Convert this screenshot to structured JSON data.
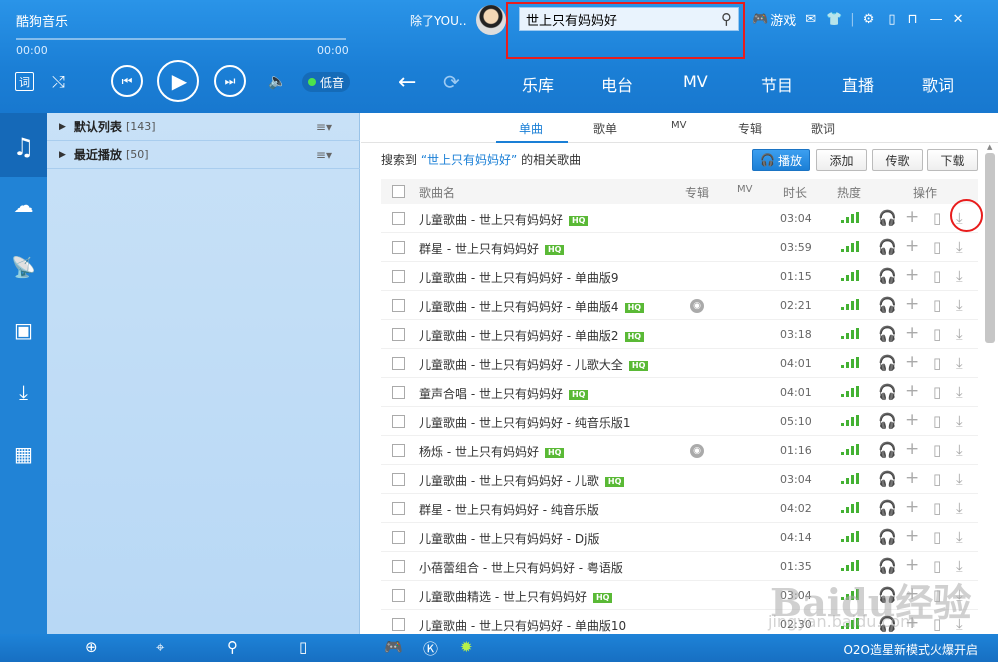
{
  "app": {
    "title": "酷狗音乐",
    "time_elapsed": "00:00",
    "time_total": "00:00",
    "progress": 0
  },
  "player": {
    "lyric_label": "词",
    "quality_label": "低音"
  },
  "user": {
    "name": "除了YOU.."
  },
  "search": {
    "value": "世上只有妈妈好"
  },
  "topbar": {
    "game_label": "游戏"
  },
  "nav": {
    "items": [
      "乐库",
      "电台",
      "MV",
      "节目",
      "直播",
      "歌词"
    ]
  },
  "playlists": [
    {
      "label": "默认列表",
      "count": "[143]"
    },
    {
      "label": "最近播放",
      "count": "[50]"
    }
  ],
  "tabs": [
    "单曲",
    "歌单",
    "MV",
    "专辑",
    "歌词"
  ],
  "result": {
    "prefix": "搜索到",
    "query": "“世上只有妈妈好”",
    "suffix": "的相关歌曲"
  },
  "actions": {
    "play": "播放",
    "add": "添加",
    "share": "传歌",
    "download": "下载"
  },
  "columns": {
    "name": "歌曲名",
    "album": "专辑",
    "mv": "MV",
    "duration": "时长",
    "heat": "热度",
    "ops": "操作"
  },
  "songs": [
    {
      "name": "儿童歌曲 - 世上只有妈妈好",
      "hq": "HQ",
      "album": false,
      "duration": "03:04"
    },
    {
      "name": "群星 - 世上只有妈妈好",
      "hq": "HQ",
      "album": false,
      "duration": "03:59"
    },
    {
      "name": "儿童歌曲 - 世上只有妈妈好 - 单曲版9",
      "hq": "",
      "album": false,
      "duration": "01:15"
    },
    {
      "name": "儿童歌曲 - 世上只有妈妈好 - 单曲版4",
      "hq": "HQ",
      "album": true,
      "duration": "02:21"
    },
    {
      "name": "儿童歌曲 - 世上只有妈妈好 - 单曲版2",
      "hq": "HQ",
      "album": false,
      "duration": "03:18"
    },
    {
      "name": "儿童歌曲 - 世上只有妈妈好 - 儿歌大全",
      "hq": "HQ",
      "album": false,
      "duration": "04:01"
    },
    {
      "name": "童声合唱 - 世上只有妈妈好",
      "hq": "HQ",
      "album": false,
      "duration": "04:01"
    },
    {
      "name": "儿童歌曲 - 世上只有妈妈好 - 纯音乐版1",
      "hq": "",
      "album": false,
      "duration": "05:10"
    },
    {
      "name": "杨烁 - 世上只有妈妈好",
      "hq": "HQ",
      "album": true,
      "duration": "01:16"
    },
    {
      "name": "儿童歌曲 - 世上只有妈妈好 - 儿歌",
      "hq": "HQ",
      "album": false,
      "duration": "03:04"
    },
    {
      "name": "群星 - 世上只有妈妈好 - 纯音乐版",
      "hq": "",
      "album": false,
      "duration": "04:02"
    },
    {
      "name": "儿童歌曲 - 世上只有妈妈好 - Dj版",
      "hq": "",
      "album": false,
      "duration": "04:14"
    },
    {
      "name": "小蓓蕾组合 - 世上只有妈妈好 - 粤语版",
      "hq": "",
      "album": false,
      "duration": "01:35"
    },
    {
      "name": "儿童歌曲精选 - 世上只有妈妈好",
      "hq": "HQ",
      "album": false,
      "duration": "03:04"
    },
    {
      "name": "儿童歌曲 - 世上只有妈妈好 - 单曲版10",
      "hq": "",
      "album": false,
      "duration": "02:30"
    }
  ],
  "footer": {
    "promo": "O2O造星新模式火爆开启"
  },
  "watermark": {
    "text": "Baidu经验",
    "url": "jingyan.baidu.com"
  },
  "colors": {
    "accent": "#1a7fd6",
    "highlight_box": "#e81c1c",
    "heat": "#43b132"
  }
}
